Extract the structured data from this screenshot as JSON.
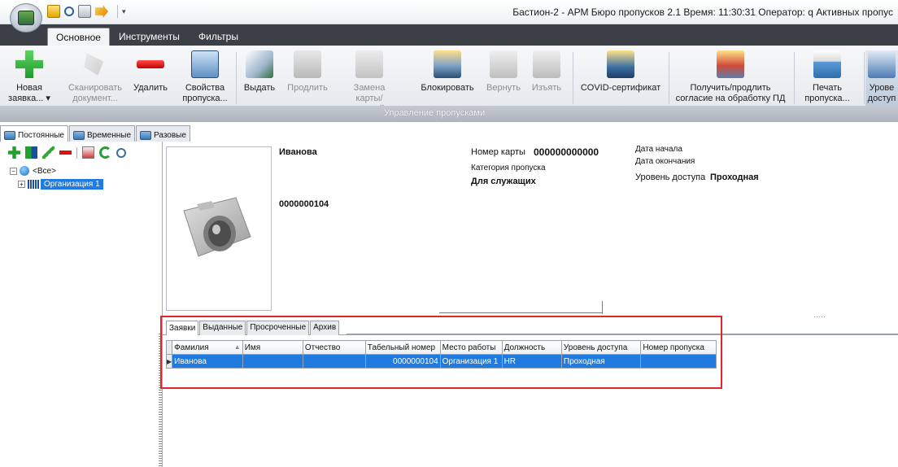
{
  "window": {
    "title": "Бастион-2 - АРМ Бюро пропусков 2.1 Время: 11:30:31 Оператор: q  Активных пропус"
  },
  "ribbon_tabs": [
    {
      "label": "Основное",
      "active": true
    },
    {
      "label": "Инструменты",
      "active": false
    },
    {
      "label": "Фильтры",
      "active": false
    }
  ],
  "ribbon": {
    "buttons": [
      {
        "line1": "Новая",
        "line2": "заявка... ▾",
        "icon": "plus-icon",
        "enabled": true
      },
      {
        "line1": "Сканировать",
        "line2": "документ...",
        "icon": "scan-icon",
        "enabled": false
      },
      {
        "line1": "Удалить",
        "line2": "",
        "icon": "minus-icon",
        "enabled": true
      },
      {
        "line1": "Свойства",
        "line2": "пропуска...",
        "icon": "properties-icon",
        "enabled": true
      },
      {
        "line1": "Выдать",
        "line2": "",
        "icon": "issue-pass-icon",
        "enabled": true
      },
      {
        "line1": "Продлить",
        "line2": "",
        "icon": "extend-icon",
        "enabled": false
      },
      {
        "line1": "Замена",
        "line2": "карты/ключей",
        "icon": "replace-card-icon",
        "enabled": false
      },
      {
        "line1": "Блокировать",
        "line2": "",
        "icon": "block-icon",
        "enabled": true
      },
      {
        "line1": "Вернуть",
        "line2": "",
        "icon": "return-icon",
        "enabled": false
      },
      {
        "line1": "Изъять",
        "line2": "",
        "icon": "withdraw-icon",
        "enabled": false
      },
      {
        "line1": "COVID-сертификат",
        "line2": "",
        "icon": "covid-certificate-icon",
        "enabled": true
      },
      {
        "line1": "Получить/продлить",
        "line2": "согласие на обработку ПД",
        "icon": "consent-icon",
        "enabled": true
      },
      {
        "line1": "Печать",
        "line2": "пропуска...",
        "icon": "printer-icon",
        "enabled": true
      },
      {
        "line1": "Урове",
        "line2": "доступ",
        "icon": "access-level-icon",
        "enabled": true
      }
    ],
    "group_label": "Управление пропусками"
  },
  "pass_tabs": [
    {
      "label": "Постоянные",
      "active": true
    },
    {
      "label": "Временные",
      "active": false
    },
    {
      "label": "Разовые",
      "active": false
    }
  ],
  "tree": {
    "root": "<Все>",
    "child": "Организация 1"
  },
  "details": {
    "surname": "Иванова",
    "tab_number": "0000000104",
    "card_number_label": "Номер карты",
    "card_number": "000000000000",
    "category_label": "Категория пропуска",
    "category": "Для служащих",
    "start_date_label": "Дата начала",
    "end_date_label": "Дата окончания",
    "access_level_label": "Уровень доступа",
    "access_level": "Проходная"
  },
  "lower_tabs": [
    {
      "label": "Заявки",
      "active": true
    },
    {
      "label": "Выданные",
      "active": false
    },
    {
      "label": "Просроченные",
      "active": false
    },
    {
      "label": "Архив",
      "active": false
    }
  ],
  "grid": {
    "columns": [
      "Фамилия",
      "Имя",
      "Отчество",
      "Табельный номер",
      "Место работы",
      "Должность",
      "Уровень доступа",
      "Номер пропуска"
    ],
    "rows": [
      {
        "surname": "Иванова",
        "name": "",
        "patronymic": "",
        "tab_number": "0000000104",
        "workplace": "Организация 1",
        "position": "HR",
        "access_level": "Проходная",
        "pass_number": ""
      }
    ]
  },
  "colors": {
    "selection": "#1f7be0",
    "highlight_box": "#e0252b",
    "tabstrip": "#3c3f45"
  }
}
